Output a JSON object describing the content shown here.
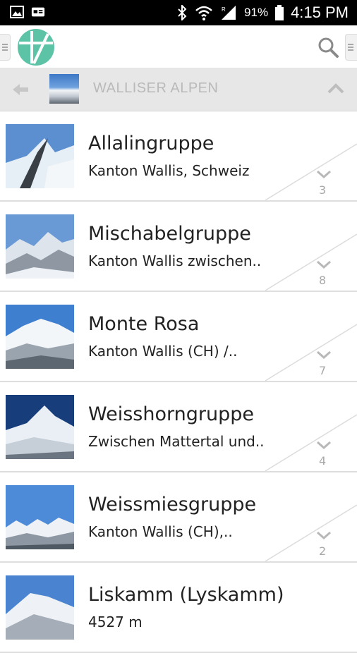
{
  "status_bar": {
    "battery": "91%",
    "time": "4:15 PM"
  },
  "app_bar": {
    "logo_icon": "app-logo-icon",
    "search_icon": "search-icon"
  },
  "breadcrumb": {
    "title": "WALLISER ALPEN"
  },
  "list": [
    {
      "title": "Allalingruppe",
      "subtitle": "Kanton Wallis, Schweiz",
      "count": "3"
    },
    {
      "title": "Mischabelgruppe",
      "subtitle": "Kanton Wallis zwischen..",
      "count": "8"
    },
    {
      "title": "Monte Rosa",
      "subtitle": "Kanton Wallis (CH) /..",
      "count": "7"
    },
    {
      "title": "Weisshorngruppe",
      "subtitle": "Zwischen Mattertal und..",
      "count": "4"
    },
    {
      "title": "Weissmiesgruppe",
      "subtitle": "Kanton Wallis (CH),..",
      "count": "2"
    },
    {
      "title": "Liskamm (Lyskamm)",
      "subtitle": "4527 m",
      "count": ""
    }
  ],
  "colors": {
    "accent": "#5cc3a6",
    "crumb_bg": "#e7e7e7",
    "text": "#222222",
    "muted": "#a8a8a8"
  }
}
